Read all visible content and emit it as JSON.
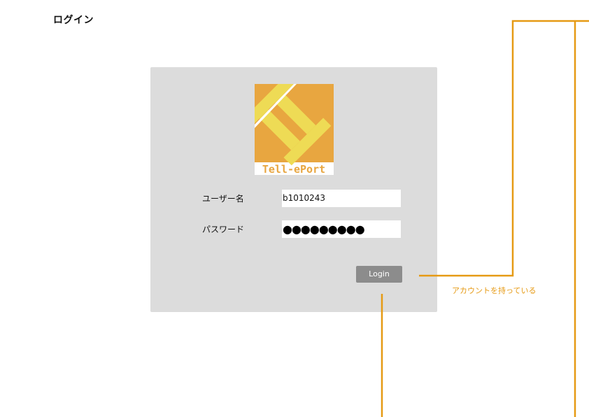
{
  "page": {
    "title": "ログイン"
  },
  "logo": {
    "name": "tell-eport-logo",
    "text": "Tell-ePort",
    "background_color": "#e8a640",
    "glyph_color": "#eedb55",
    "text_color": "#e8a640"
  },
  "form": {
    "username": {
      "label": "ユーザー名",
      "value": "b1010243"
    },
    "password": {
      "label": "パスワード",
      "value": "●●●●●●●●●"
    },
    "login_button": {
      "label": "Login",
      "color": "#8c8c8c"
    }
  },
  "annotations": {
    "has_account": "アカウントを持っている",
    "connector_color": "#e69a14"
  },
  "colors": {
    "panel_background": "#dcdcdc",
    "page_background": "#ffffff"
  }
}
